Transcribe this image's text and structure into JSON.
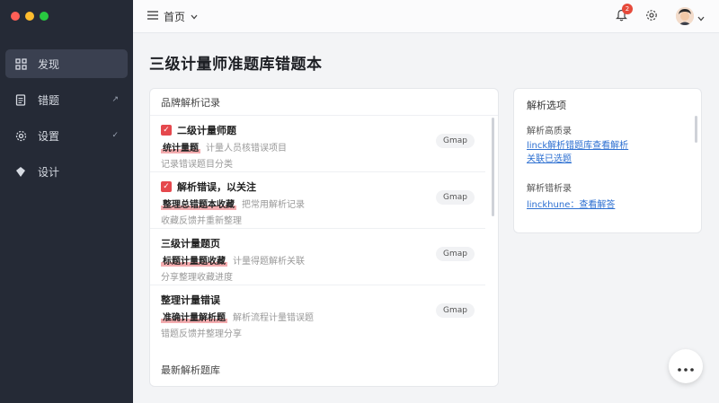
{
  "sidebar": {
    "items": [
      {
        "label": "发现",
        "icon": "grid-icon",
        "chev": ""
      },
      {
        "label": "错题",
        "icon": "document-icon",
        "chev": "↗"
      },
      {
        "label": "设置",
        "icon": "gear-icon",
        "chev": "✓"
      },
      {
        "label": "设计",
        "icon": "diamond-icon",
        "chev": ""
      }
    ]
  },
  "topbar": {
    "menu_label": "首页",
    "notification_count": "2"
  },
  "page": {
    "title": "三级计量师准题库错题本"
  },
  "left_card": {
    "header": "品牌解析记录",
    "rows": [
      {
        "title": "二级计量师题",
        "checked": true,
        "line1_hl": "统计量题",
        "line1_muted": "计量人员核错误项目",
        "line2": "记录错误题目分类",
        "pill": "Gmap"
      },
      {
        "title": "解析错误，以关注",
        "checked": true,
        "line1_hl": "整理总错题本收藏",
        "line1_muted": "把常用解析记录",
        "line2": "收藏反馈并重新整理",
        "pill": "Gmap"
      },
      {
        "title": "三级计量题页",
        "checked": false,
        "line1_hl": "标题计量题收藏",
        "line1_muted": "计量得题解析关联",
        "line2": "分享整理收藏进度",
        "pill": "Gmap"
      },
      {
        "title": "整理计量错误",
        "checked": false,
        "line1_hl": "准确计量解析题",
        "line1_muted": "解析流程计量错误题",
        "line2": "错题反馈并整理分享",
        "pill": "Gmap"
      }
    ],
    "footer": "最新解析题库"
  },
  "right_card": {
    "title": "解析选项",
    "sub1": "解析高质录",
    "link1": "linck解析错题库查看解析",
    "link1b": "关联已选题",
    "sub2": "解析错析录",
    "link2": "linckhune：查看解答"
  },
  "colors": {
    "sidebar_bg": "#252a36",
    "accent_red": "#e5484d",
    "link_blue": "#2c6fd1"
  }
}
